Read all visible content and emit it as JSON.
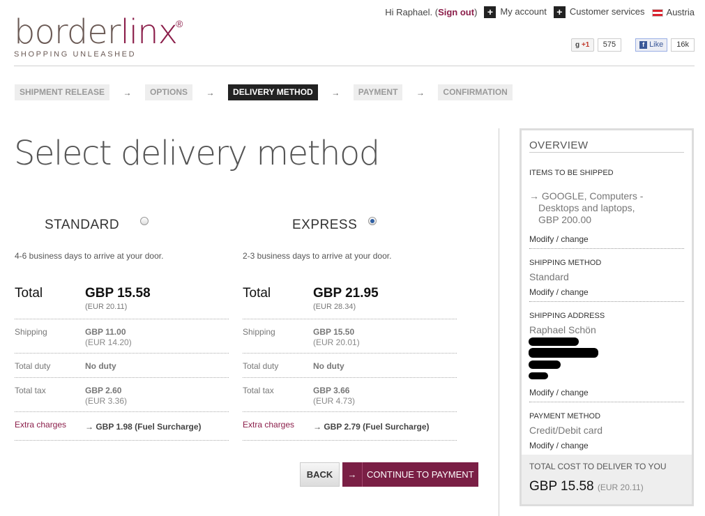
{
  "header": {
    "logo_word_a": "border",
    "logo_word_b": "linx",
    "logo_reg": "®",
    "tagline": "SHOPPING UNLEASHED",
    "greeting": "Hi Raphael. (",
    "sign_out": "Sign out",
    "greeting_end": ")",
    "my_account": "My account",
    "customer_services": "Customer services",
    "country": "Austria",
    "gplus_label": "+1",
    "gplus_count": "575",
    "fb_label": "Like",
    "fb_count": "16k"
  },
  "steps": [
    {
      "label": "SHIPMENT RELEASE",
      "active": false
    },
    {
      "label": "OPTIONS",
      "active": false
    },
    {
      "label": "DELIVERY METHOD",
      "active": true
    },
    {
      "label": "PAYMENT",
      "active": false
    },
    {
      "label": "CONFIRMATION",
      "active": false
    }
  ],
  "step_arrow": "→",
  "page_title": "Select delivery method",
  "options": {
    "standard": {
      "name": "STANDARD",
      "selected": false,
      "description": "4-6 business days to arrive at your door.",
      "total_label": "Total",
      "total_gbp": "GBP 15.58",
      "total_eur": "(EUR 20.11)",
      "shipping_label": "Shipping",
      "shipping_gbp": "GBP 11.00",
      "shipping_eur": "(EUR 14.20)",
      "duty_label": "Total duty",
      "duty_value": "No duty",
      "tax_label": "Total tax",
      "tax_gbp": "GBP 2.60",
      "tax_eur": "(EUR 3.36)",
      "extra_label": "Extra charges",
      "extra_value": "→ GBP 1.98 (Fuel Surcharge)"
    },
    "express": {
      "name": "EXPRESS",
      "selected": true,
      "description": "2-3 business days to arrive at your door.",
      "total_label": "Total",
      "total_gbp": "GBP 21.95",
      "total_eur": "(EUR 28.34)",
      "shipping_label": "Shipping",
      "shipping_gbp": "GBP 15.50",
      "shipping_eur": "(EUR 20.01)",
      "duty_label": "Total duty",
      "duty_value": "No duty",
      "tax_label": "Total tax",
      "tax_gbp": "GBP 3.66",
      "tax_eur": "(EUR 4.73)",
      "extra_label": "Extra charges",
      "extra_value": "→ GBP 2.79 (Fuel Surcharge)"
    }
  },
  "buttons": {
    "back": "BACK",
    "continue_arrow": "→",
    "continue": "CONTINUE TO PAYMENT"
  },
  "overview": {
    "title": "OVERVIEW",
    "items_head": "ITEMS TO BE SHIPPED",
    "item_line1": "→ GOOGLE, Computers -",
    "item_line2": "Desktops and laptops,",
    "item_line3": "GBP 200.00",
    "modify": "Modify / change",
    "shipping_method_head": "SHIPPING METHOD",
    "shipping_method": "Standard",
    "shipping_address_head": "SHIPPING ADDRESS",
    "address_name": "Raphael Schön",
    "payment_method_head": "PAYMENT METHOD",
    "payment_method": "Credit/Debit card",
    "total_cost_label": "TOTAL COST TO DELIVER TO YOU",
    "total_cost_gbp": "GBP 15.58",
    "total_cost_eur": "(EUR 20.11)"
  },
  "colors": {
    "brand": "#8b1e4a",
    "button_primary": "#7a1f45",
    "active_step": "#222222"
  }
}
